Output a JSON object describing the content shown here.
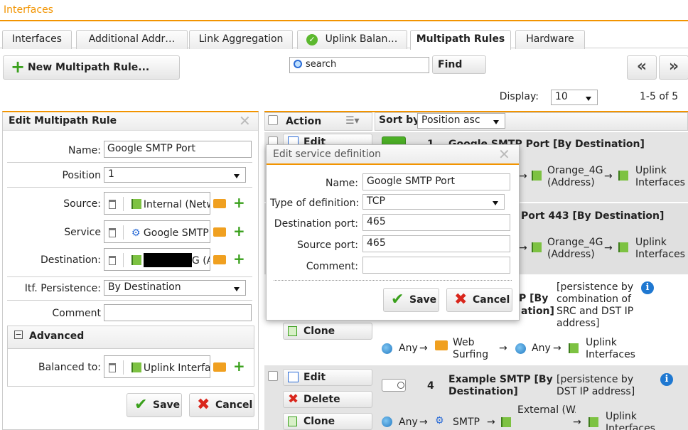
{
  "header": {
    "title": "Interfaces"
  },
  "tabs": [
    {
      "label": "Interfaces"
    },
    {
      "label": "Additional Addr…"
    },
    {
      "label": "Link Aggregation"
    },
    {
      "label": "Uplink Balan…"
    },
    {
      "label": "Multipath Rules"
    },
    {
      "label": "Hardware"
    }
  ],
  "toolbar": {
    "new_rule_label": "New Multipath Rule...",
    "search_placeholder": "search",
    "find_label": "Find",
    "display_label": "Display:",
    "display_value": "10",
    "pagination_info": "1-5 of 5"
  },
  "edit_panel": {
    "title": "Edit Multipath Rule",
    "name_label": "Name:",
    "name_value": "Google SMTP Port",
    "position_label": "Position",
    "position_value": "1",
    "source_label": "Source:",
    "source_value": "Internal (Netw",
    "service_label": "Service",
    "service_value": "Google SMTP",
    "destination_label": "Destination:",
    "destination_value": "G (A",
    "persistence_label": "Itf. Persistence:",
    "persistence_value": "By Destination",
    "comment_label": "Comment",
    "advanced_label": "Advanced",
    "balanced_label": "Balanced to:",
    "balanced_value": "Uplink Interfac",
    "save_label": "Save",
    "cancel_label": "Cancel"
  },
  "list": {
    "action_label": "Action",
    "sort_label": "Sort by:",
    "sort_value": "Position asc",
    "rows": [
      {
        "edit": "Edit",
        "num": "1",
        "title": "Google SMTP Port [By Destination]",
        "middle": "Orange_4G (Address)",
        "dest": "Uplink Interfaces"
      },
      {
        "title": "Port 443 [By Destination]",
        "middle": "Orange_4G (Address)",
        "dest": "Uplink Interfaces"
      },
      {
        "title_a": "P [By",
        "title_b": "ation]",
        "persist": "[persistence by combination of SRC and DST IP address]",
        "clone": "Clone",
        "src": "Any",
        "svc": "Web Surfing",
        "dst": "Any",
        "dest": "Uplink Interfaces"
      },
      {
        "edit": "Edit",
        "delete": "Delete",
        "clone": "Clone",
        "num": "4",
        "title": "Example SMTP [By Destination]",
        "persist": "[persistence by DST IP address]",
        "src": "Any",
        "svc": "SMTP",
        "dst": "External (WAN)_Vod",
        "dest": "Uplink Interfaces"
      }
    ]
  },
  "dialog": {
    "title": "Edit service definition",
    "name_label": "Name:",
    "name_value": "Google SMTP Port",
    "type_label": "Type of definition:",
    "type_value": "TCP",
    "dport_label": "Destination port:",
    "dport_value": "465",
    "sport_label": "Source port:",
    "sport_value": "465",
    "comment_label": "Comment:",
    "save_label": "Save",
    "cancel_label": "Cancel"
  },
  "colors": {
    "accent": "#f29400",
    "green": "#3aa01c",
    "red": "#d9261c",
    "info": "#1f78d1"
  }
}
